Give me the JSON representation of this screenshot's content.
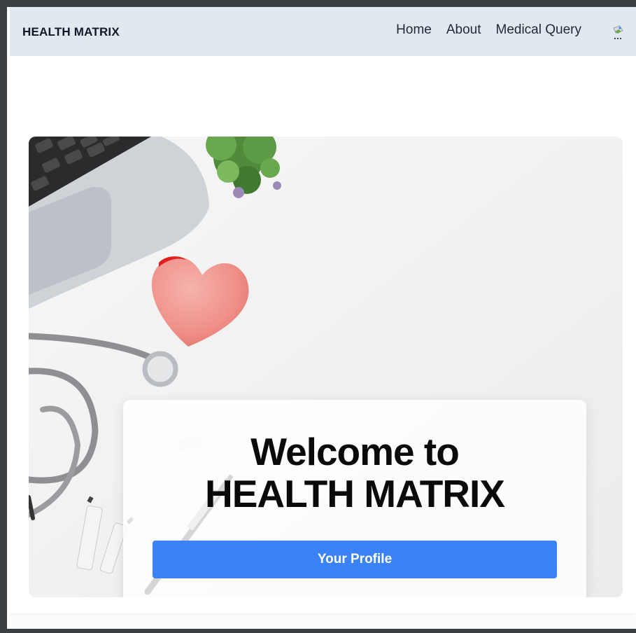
{
  "navbar": {
    "brand": "HEALTH MATRIX",
    "links": [
      {
        "label": "Home"
      },
      {
        "label": "About"
      },
      {
        "label": "Medical Query"
      }
    ]
  },
  "hero": {
    "title_line1": "Welcome to",
    "title_line2": "HEALTH MATRIX",
    "profile_button": "Your Profile"
  },
  "colors": {
    "navbar_bg": "#e2e8f0",
    "accent_button": "#3b82f6",
    "frame": "#3a3f44"
  }
}
